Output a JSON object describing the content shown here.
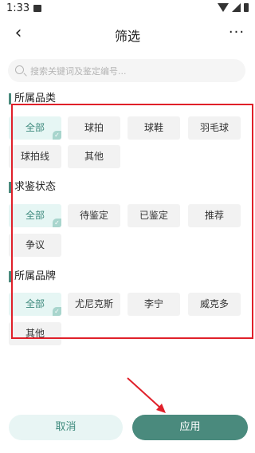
{
  "status_bar": {
    "time": "1:33"
  },
  "header": {
    "title": "筛选",
    "back_glyph": "‹",
    "more_glyph": "···"
  },
  "search": {
    "placeholder": "搜索关键词及鉴定编号...",
    "value": ""
  },
  "sections": [
    {
      "title": "所属品类",
      "options": [
        {
          "label": "全部",
          "selected": true
        },
        {
          "label": "球拍",
          "selected": false
        },
        {
          "label": "球鞋",
          "selected": false
        },
        {
          "label": "羽毛球",
          "selected": false
        },
        {
          "label": "球拍线",
          "selected": false
        },
        {
          "label": "其他",
          "selected": false
        }
      ]
    },
    {
      "title": "求鉴状态",
      "options": [
        {
          "label": "全部",
          "selected": true
        },
        {
          "label": "待鉴定",
          "selected": false
        },
        {
          "label": "已鉴定",
          "selected": false
        },
        {
          "label": "推荐",
          "selected": false
        },
        {
          "label": "争议",
          "selected": false
        }
      ]
    },
    {
      "title": "所属品牌",
      "options": [
        {
          "label": "全部",
          "selected": true
        },
        {
          "label": "尤尼克斯",
          "selected": false
        },
        {
          "label": "李宁",
          "selected": false
        },
        {
          "label": "威克多",
          "selected": false
        },
        {
          "label": "其他",
          "selected": false
        }
      ]
    }
  ],
  "footer": {
    "cancel_label": "取消",
    "apply_label": "应用"
  },
  "colors": {
    "accent": "#4a8a7d",
    "annotation": "#e0202a"
  }
}
